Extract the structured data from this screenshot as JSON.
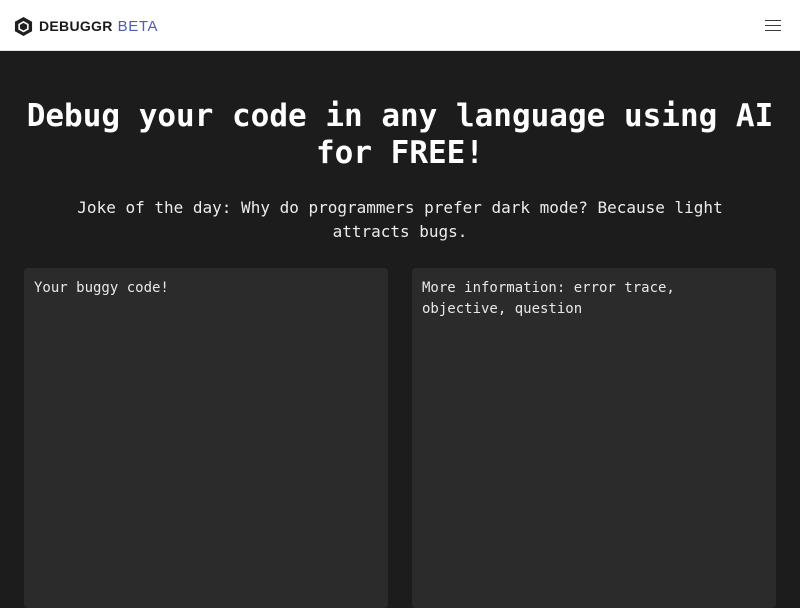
{
  "header": {
    "brand_name": "DEBUGGR",
    "brand_badge": "BETA",
    "logo_icon": "hexagon-logo-icon",
    "menu_icon": "hamburger-menu-icon"
  },
  "hero": {
    "headline": "Debug your code in any language using AI for FREE!",
    "joke": "Joke of the day: Why do programmers prefer dark mode? Because light attracts bugs."
  },
  "form": {
    "code_placeholder": "Your buggy code!",
    "code_value": "",
    "info_placeholder": "More information: error trace, objective, question",
    "info_value": ""
  },
  "colors": {
    "page_background": "#1c1c1d",
    "navbar_background": "#ffffff",
    "editor_background": "#2b2b2c",
    "badge_accent": "#4f5bb8"
  }
}
